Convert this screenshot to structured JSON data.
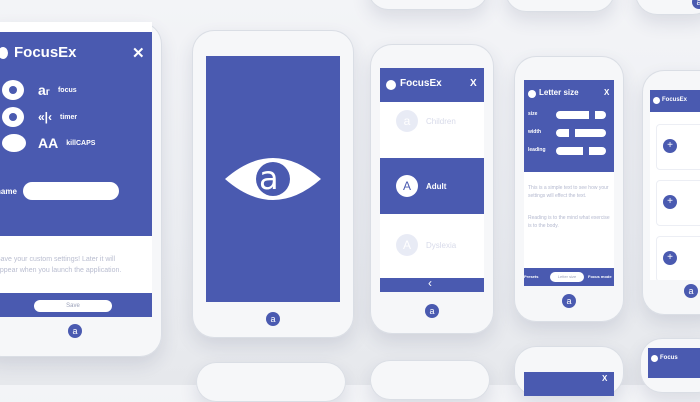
{
  "app_name": "FocusEx",
  "phone1": {
    "close": "✕",
    "features": [
      {
        "icon": "eye-icon",
        "label": "focus"
      },
      {
        "icon": "eye-closed-icon",
        "label": "timer"
      },
      {
        "icon": "aa-icon",
        "label": "killCAPS"
      }
    ],
    "name_label": "name",
    "name_value": "",
    "help_text": "Save your custom settings! Later it will appear when you launch the application.",
    "save_label": "Save",
    "home_icon": "a"
  },
  "phone2": {
    "logo_glyph": "a",
    "home_icon": "a"
  },
  "phone3": {
    "close": "X",
    "options": [
      {
        "glyph": "a",
        "label": "Children"
      },
      {
        "glyph": "A",
        "label": "Adult"
      },
      {
        "glyph": "A",
        "label": "Dyslexia"
      }
    ],
    "back_glyph": "‹",
    "home_icon": "a"
  },
  "phone4": {
    "title": "Letter size",
    "close": "X",
    "sliders": [
      {
        "label": "size",
        "value": 0.7
      },
      {
        "label": "width",
        "value": 0.3
      },
      {
        "label": "leading",
        "value": 0.6
      }
    ],
    "preview_text_1": "This is a simple text to see how your settings will effect the text.",
    "preview_text_2": "Reading is to the mind what exercise is to the body.",
    "tabs": [
      "Presets",
      "Letter size",
      "Focus mode"
    ],
    "home_icon": "a"
  },
  "phone5": {
    "title": "FocusEx",
    "home_icon": "a"
  },
  "phone6": {
    "title": "Focus"
  }
}
